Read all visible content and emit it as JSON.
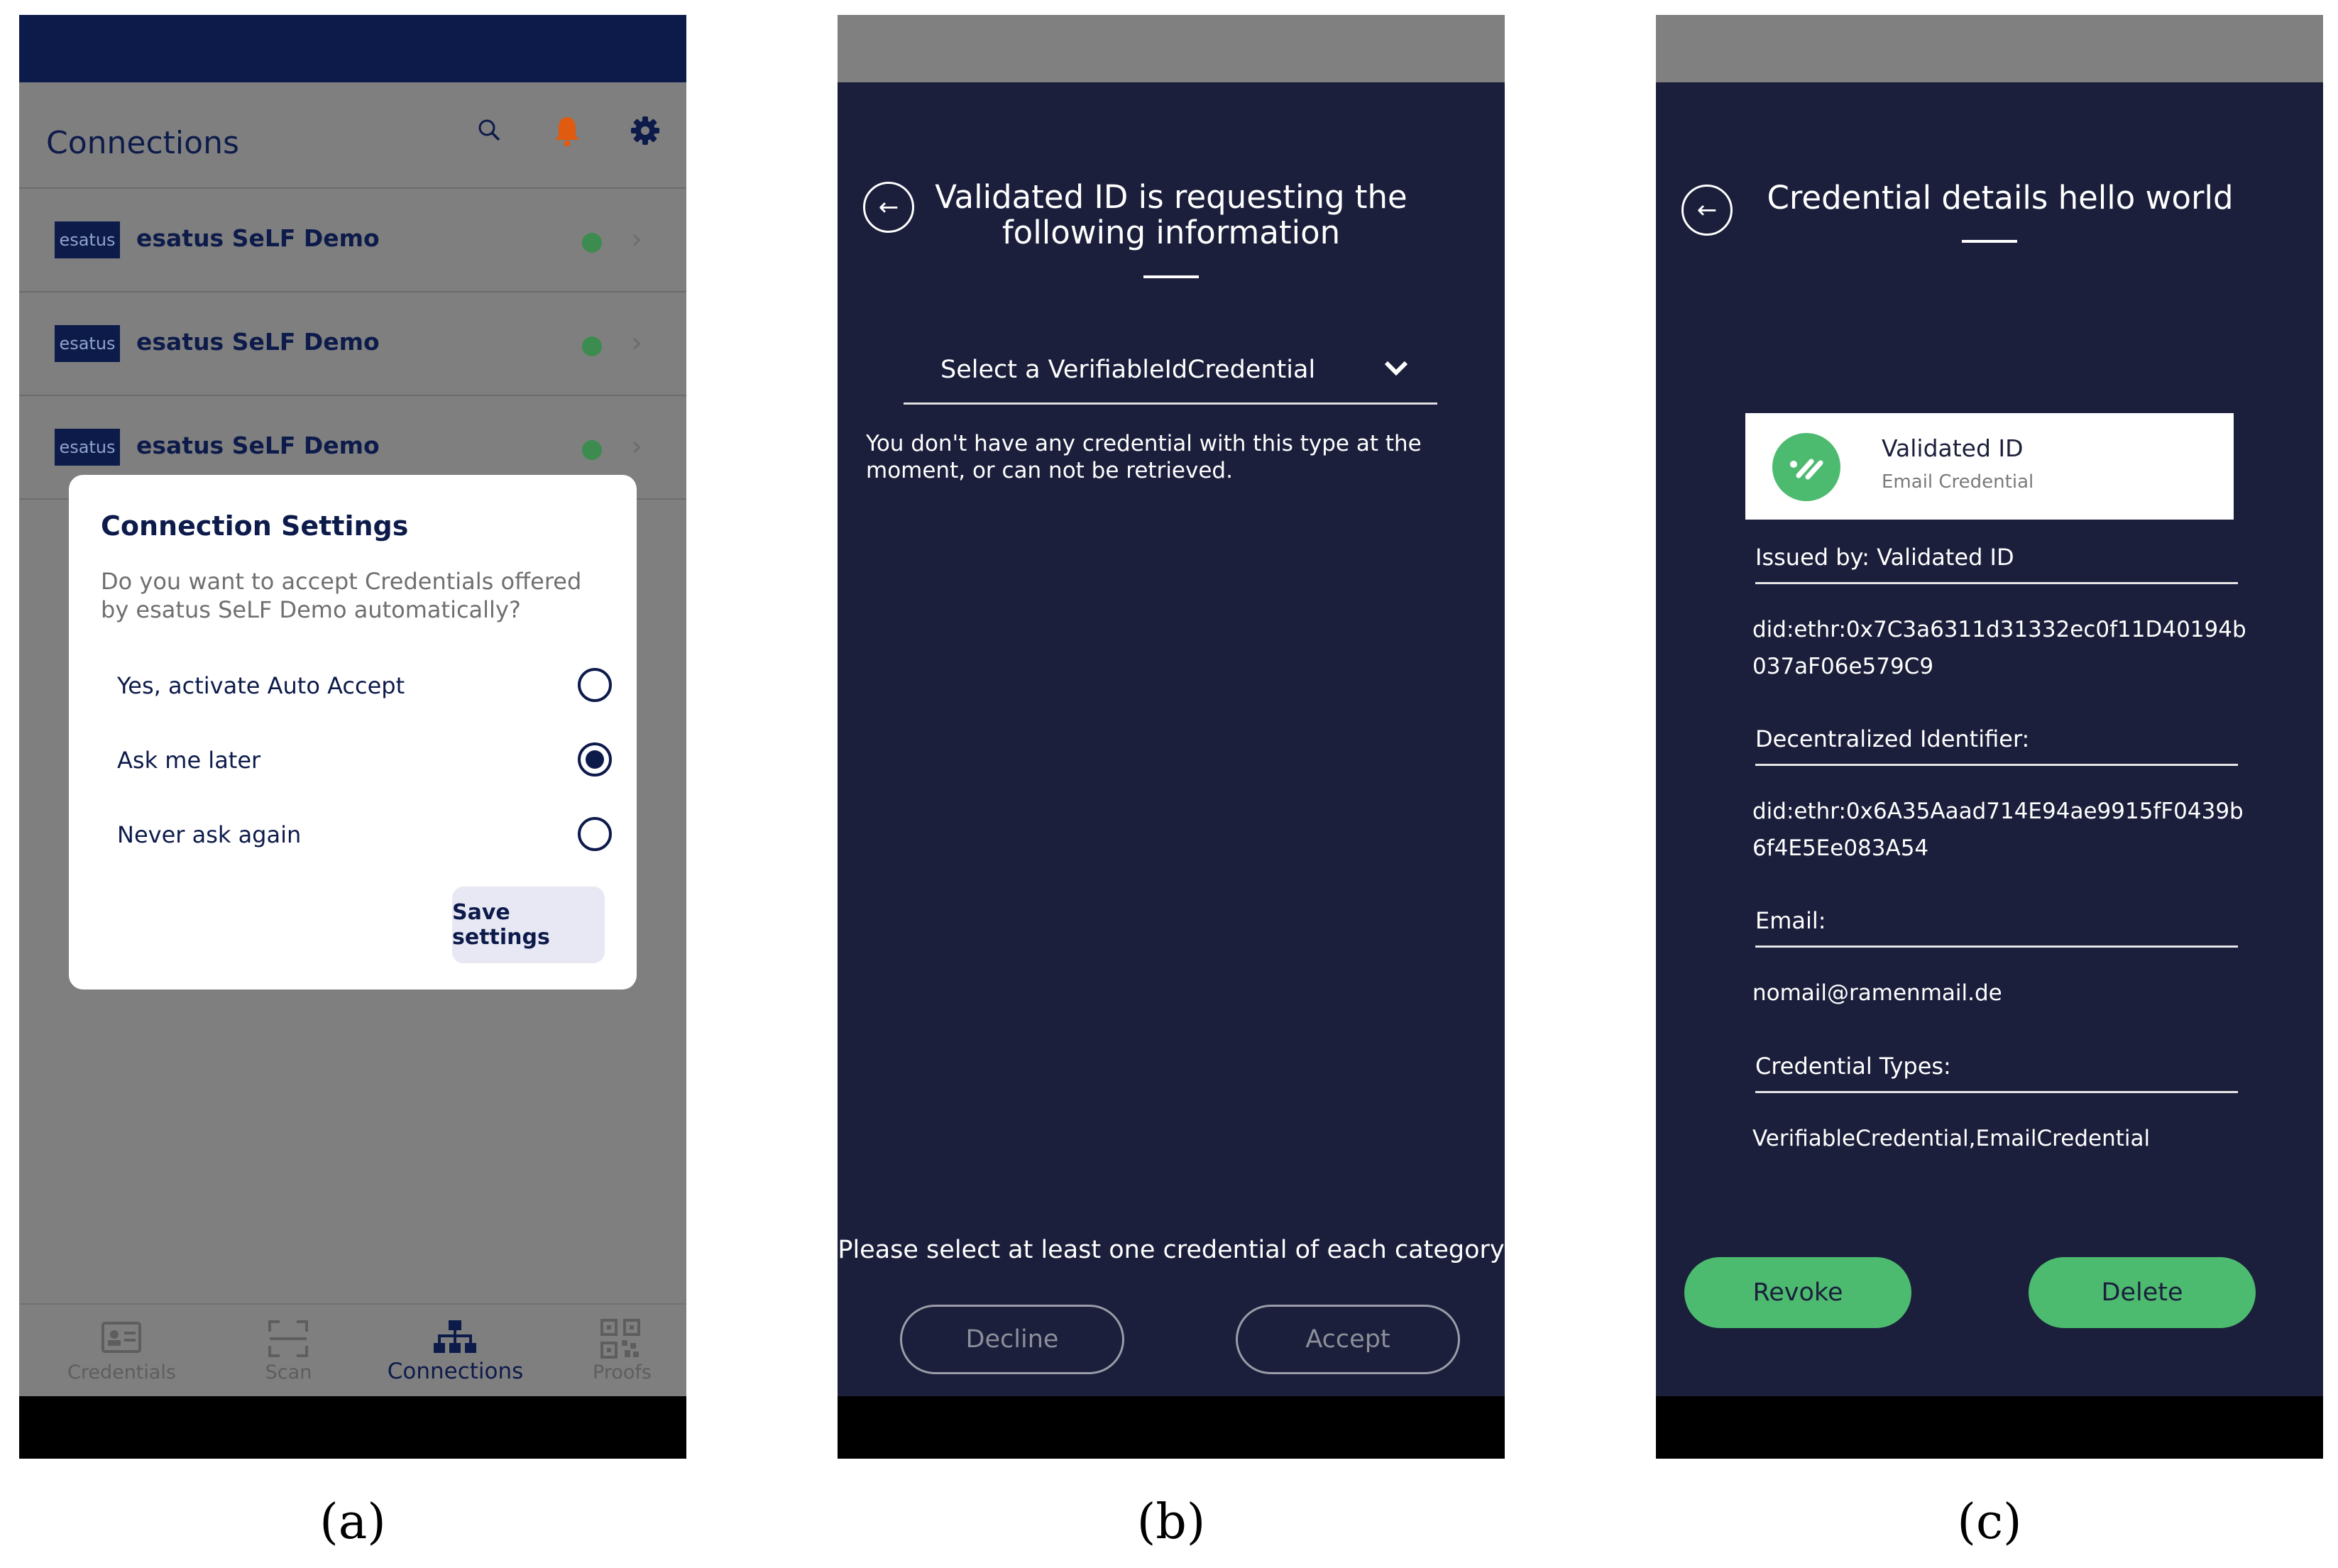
{
  "panel_a": {
    "title": "Connections",
    "icons": [
      "search-icon",
      "bell-icon",
      "gear-icon"
    ],
    "bell_color": "#e05a10",
    "connections": [
      {
        "logo": "esatus",
        "name": "esatus SeLF Demo",
        "status_color": "#3c8b4f"
      },
      {
        "logo": "esatus",
        "name": "esatus SeLF Demo",
        "status_color": "#3c8b4f"
      },
      {
        "logo": "esatus",
        "name": "esatus SeLF Demo",
        "status_color": "#3c8b4f"
      }
    ],
    "dialog": {
      "title": "Connection Settings",
      "question": "Do you want to accept Credentials offered by esatus SeLF Demo automatically?",
      "options": [
        {
          "label": "Yes, activate Auto Accept",
          "selected": false
        },
        {
          "label": "Ask me later",
          "selected": true
        },
        {
          "label": "Never ask again",
          "selected": false
        }
      ],
      "save_label": "Save settings"
    },
    "nav": [
      {
        "label": "Credentials",
        "icon": "id-card-icon",
        "active": false
      },
      {
        "label": "Scan",
        "icon": "scan-icon",
        "active": false
      },
      {
        "label": "Connections",
        "icon": "network-icon",
        "active": true
      },
      {
        "label": "Proofs",
        "icon": "qr-code-icon",
        "active": false
      }
    ],
    "caption": "(a)"
  },
  "panel_b": {
    "title": "Validated ID is requesting the following information",
    "select_label": "Select a VerifiableIdCredential",
    "note": "You don't have any credential with this type at the moment, or can not be retrieved.",
    "hint": "Please select at least one credential of each category",
    "decline_label": "Decline",
    "accept_label": "Accept",
    "caption": "(b)"
  },
  "panel_c": {
    "title": "Credential details hello world",
    "card": {
      "name": "Validated ID",
      "type": "Email Credential"
    },
    "issued_by": "Issued by:  Validated ID",
    "issuer_did": "did:ethr:0x7C3a6311d31332ec0f11D40194b037aF06e579C9",
    "did_label": "Decentralized Identifier:",
    "did_value": "did:ethr:0x6A35Aaad714E94ae9915fF0439b6f4E5Ee083A54",
    "email_label": "Email:",
    "email_value": "nomail@ramenmail.de",
    "types_label": "Credential Types:",
    "types_value": "VerifiableCredential,EmailCredential",
    "revoke_label": "Revoke",
    "delete_label": "Delete",
    "accent_green": "#4dbb6f",
    "caption": "(c)"
  }
}
